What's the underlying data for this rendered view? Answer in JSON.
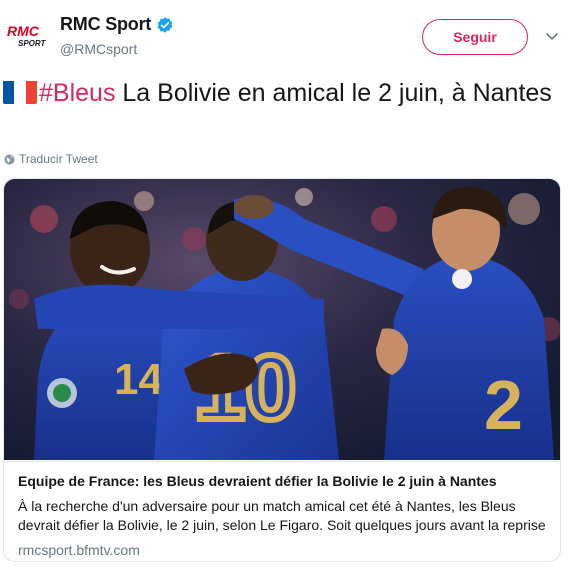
{
  "account": {
    "display_name": "RMC Sport",
    "handle": "@RMCsport",
    "verified": true,
    "avatar_icon": "rmc-sport-logo",
    "logo_text_top": "RMC",
    "logo_text_bottom": "SPORT"
  },
  "actions": {
    "follow_label": "Seguir",
    "menu_icon": "chevron-down-icon"
  },
  "tweet": {
    "flag_icon": "france-flag-icon",
    "hashtag": "#Bleus",
    "text": " La Bolivie en amical le 2 juin, à Nantes",
    "translate_label": "Traducir Tweet"
  },
  "card": {
    "title": "Equipe de France: les Bleus devraient défier la Bolivie le 2 juin à Nantes",
    "description": "À la recherche d'un adversaire pour un match amical cet été à Nantes, les Bleus devrait défier la Bolivie, le 2 juin, selon Le Figaro. Soit quelques jours avant la reprise",
    "domain": "rmcsport.bfmtv.com",
    "image_alt": "Joueurs de l'équipe de France célébrant"
  },
  "colors": {
    "accent": "#e0245e",
    "verified": "#1da1f2",
    "text": "#14171a",
    "secondary": "#657786",
    "france_blue": "#0055a4",
    "france_red": "#ef4135",
    "jersey_blue": "#1f3c9c",
    "jersey_number": "#d6b25a"
  }
}
